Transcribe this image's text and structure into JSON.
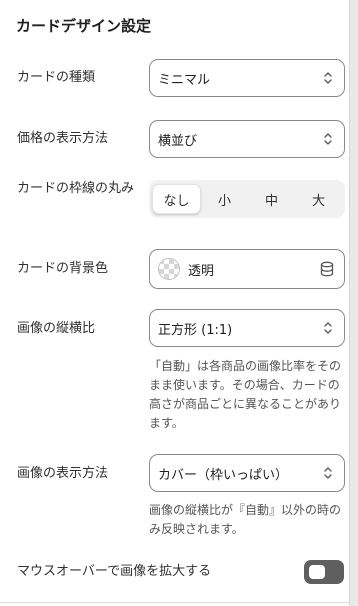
{
  "panel": {
    "title": "カードデザイン設定"
  },
  "card_type": {
    "label": "カードの種類",
    "value": "ミニマル"
  },
  "price_display": {
    "label": "価格の表示方法",
    "value": "横並び"
  },
  "corner_radius": {
    "label": "カードの枠線の丸み",
    "options": [
      "なし",
      "小",
      "中",
      "大"
    ],
    "selected": "なし"
  },
  "background_color": {
    "label": "カードの背景色",
    "value": "透明",
    "icon": "database-icon"
  },
  "aspect_ratio": {
    "label": "画像の縦横比",
    "value": "正方形 (1:1)",
    "help": "「自動」は各商品の画像比率をそのまま使います。その場合、カードの高さが商品ごとに異なることがあります。"
  },
  "image_fit": {
    "label": "画像の表示方法",
    "value": "カバー（枠いっぱい）",
    "help": "画像の縦横比が『自動』以外の時のみ反映されます。"
  },
  "hover_zoom": {
    "label": "マウスオーバーで画像を拡大する",
    "enabled": false
  },
  "colors": {
    "toggle_off": "#5f5f5f",
    "border": "#8a8a8a"
  }
}
